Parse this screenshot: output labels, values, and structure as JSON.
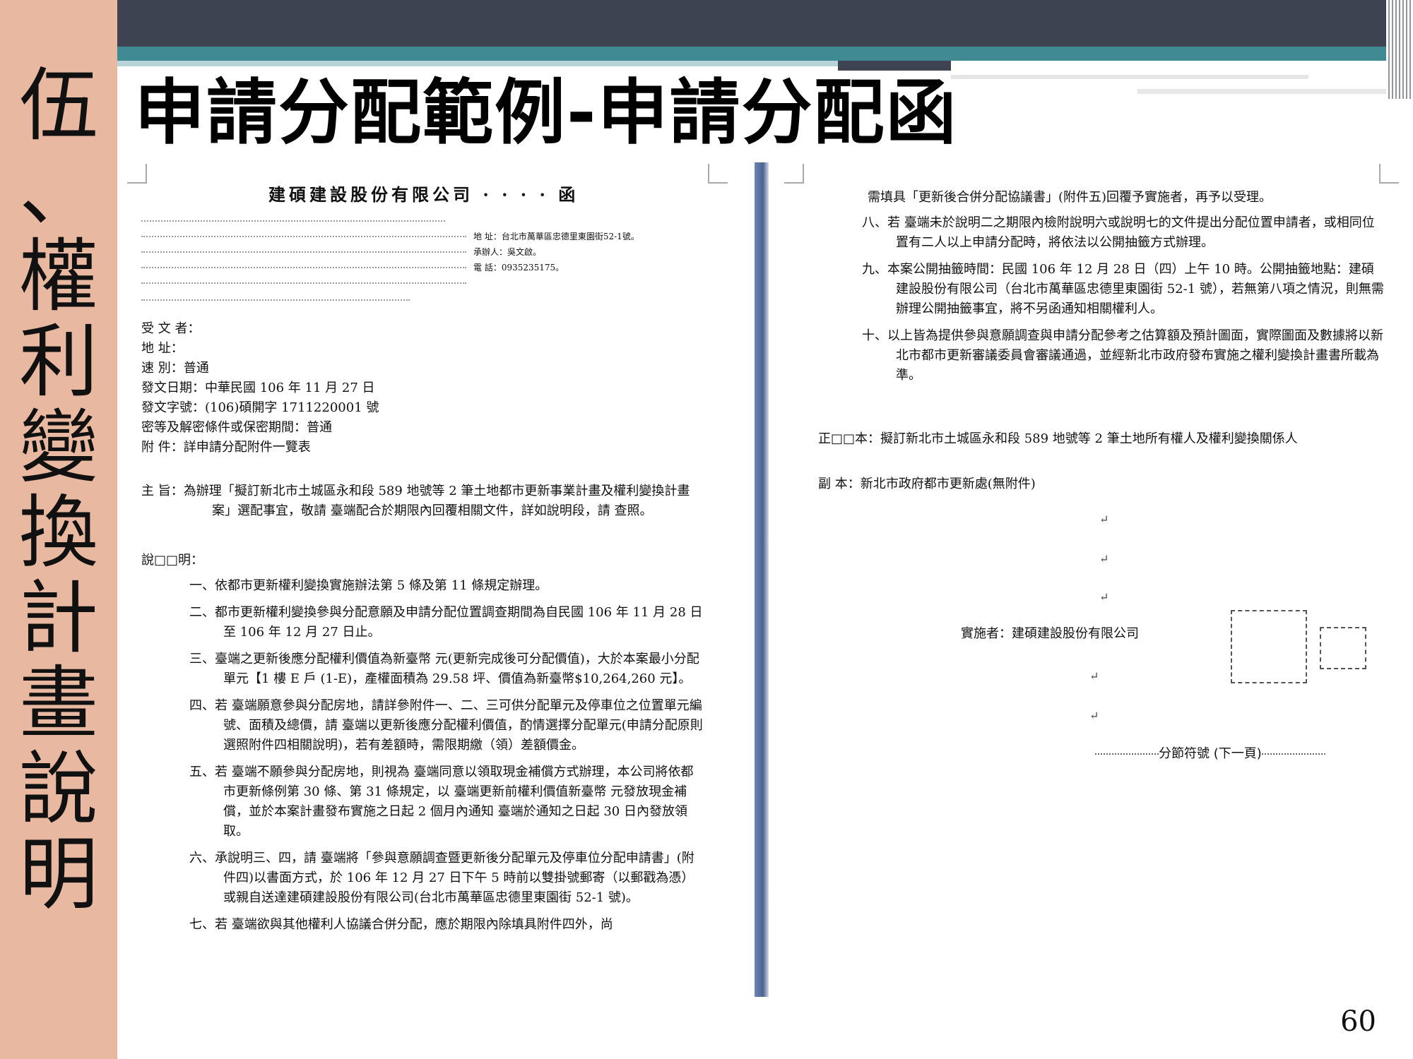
{
  "sidebar": {
    "characters": [
      "伍",
      "、",
      "權",
      "利",
      "變",
      "換",
      "計",
      "畫",
      "說",
      "明"
    ]
  },
  "slide_title": "申請分配範例-申請分配函",
  "left_page": {
    "company": "建碩建設股份有限公司 · · · · 函",
    "address_lines": [
      "地 址：台北市萬華區忠德里東園街52-1號。",
      "承辦人：吳文啟。",
      "電 話：0935235175。"
    ],
    "meta": [
      "受 文 者：",
      "地 址：",
      "速 別：普通",
      "發文日期：中華民國 106 年 11 月 27 日",
      "發文字號：(106)碩開字 1711220001 號",
      "密等及解密條件或保密期間：普通",
      "附 件：詳申請分配附件一覽表"
    ],
    "subject": "主 旨：為辦理「擬訂新北市土城區永和段 589 地號等 2 筆土地都市更新事業計畫及權利變換計畫案」選配事宜，敬請 臺端配合於期限內回覆相關文件，詳如說明段，請 查照。",
    "explain_heading": "說□□明：",
    "items": [
      "一、依都市更新權利變換實施辦法第 5 條及第 11 條規定辦理。",
      "二、都市更新權利變換參與分配意願及申請分配位置調查期間為自民國 106 年 11 月 28 日至 106 年 12 月 27 日止。",
      "三、臺端之更新後應分配權利價值為新臺幣 元(更新完成後可分配價值)，大於本案最小分配單元【1 樓 E 戶 (1-E)，產權面積為 29.58 坪、價值為新臺幣$10,264,260 元】。",
      "四、若 臺端願意參與分配房地，請詳參附件一、二、三可供分配單元及停車位之位置單元編號、面積及總價，請 臺端以更新後應分配權利價值，酌情選擇分配單元(申請分配原則選照附件四相關說明)，若有差額時，需限期繳（領）差額價金。",
      "五、若 臺端不願參與分配房地，則視為 臺端同意以領取現金補償方式辦理，本公司將依都市更新條例第 30 條、第 31 條規定，以 臺端更新前權利價值新臺幣 元發放現金補償，並於本案計畫發布實施之日起 2 個月內通知 臺端於通知之日起 30 日內發放領取。",
      "六、承說明三、四，請 臺端將「參與意願調查暨更新後分配單元及停車位分配申請書」(附件四)以書面方式，於 106 年 12 月 27 日下午 5 時前以雙掛號郵寄（以郵戳為憑）或親自送達建碩建設股份有限公司(台北市萬華區忠德里東園街 52-1 號)。",
      "七、若 臺端欲與其他權利人協議合併分配，應於期限內除填具附件四外，尚"
    ]
  },
  "right_page": {
    "items": [
      "需填具「更新後合併分配協議書」(附件五)回覆予實施者，再予以受理。",
      "八、若 臺端未於說明二之期限內檢附說明六或說明七的文件提出分配位置申請者，或相同位置有二人以上申請分配時，將依法以公開抽籤方式辦理。",
      "九、本案公開抽籤時間：民國 106 年 12 月 28 日（四）上午 10 時。公開抽籤地點：建碩建設股份有限公司（台北市萬華區忠德里東園街 52-1 號），若無第八項之情況，則無需辦理公開抽籤事宜，將不另函通知相關權利人。",
      "十、以上皆為提供參與意願調查與申請分配參考之估算額及預計圖面，實際圖面及數據將以新北市都市更新審議委員會審議通過，並經新北市政府發布實施之權利變換計畫書所載為準。"
    ],
    "original": "正□□本：擬訂新北市土城區永和段 589 地號等 2 筆土地所有權人及權利變換關係人",
    "copy": "副 本：新北市政府都市更新處(無附件)",
    "implementer": "實施者：建碩建設股份有限公司",
    "section_break": "分節符號 (下一頁)"
  },
  "page_number": "60"
}
